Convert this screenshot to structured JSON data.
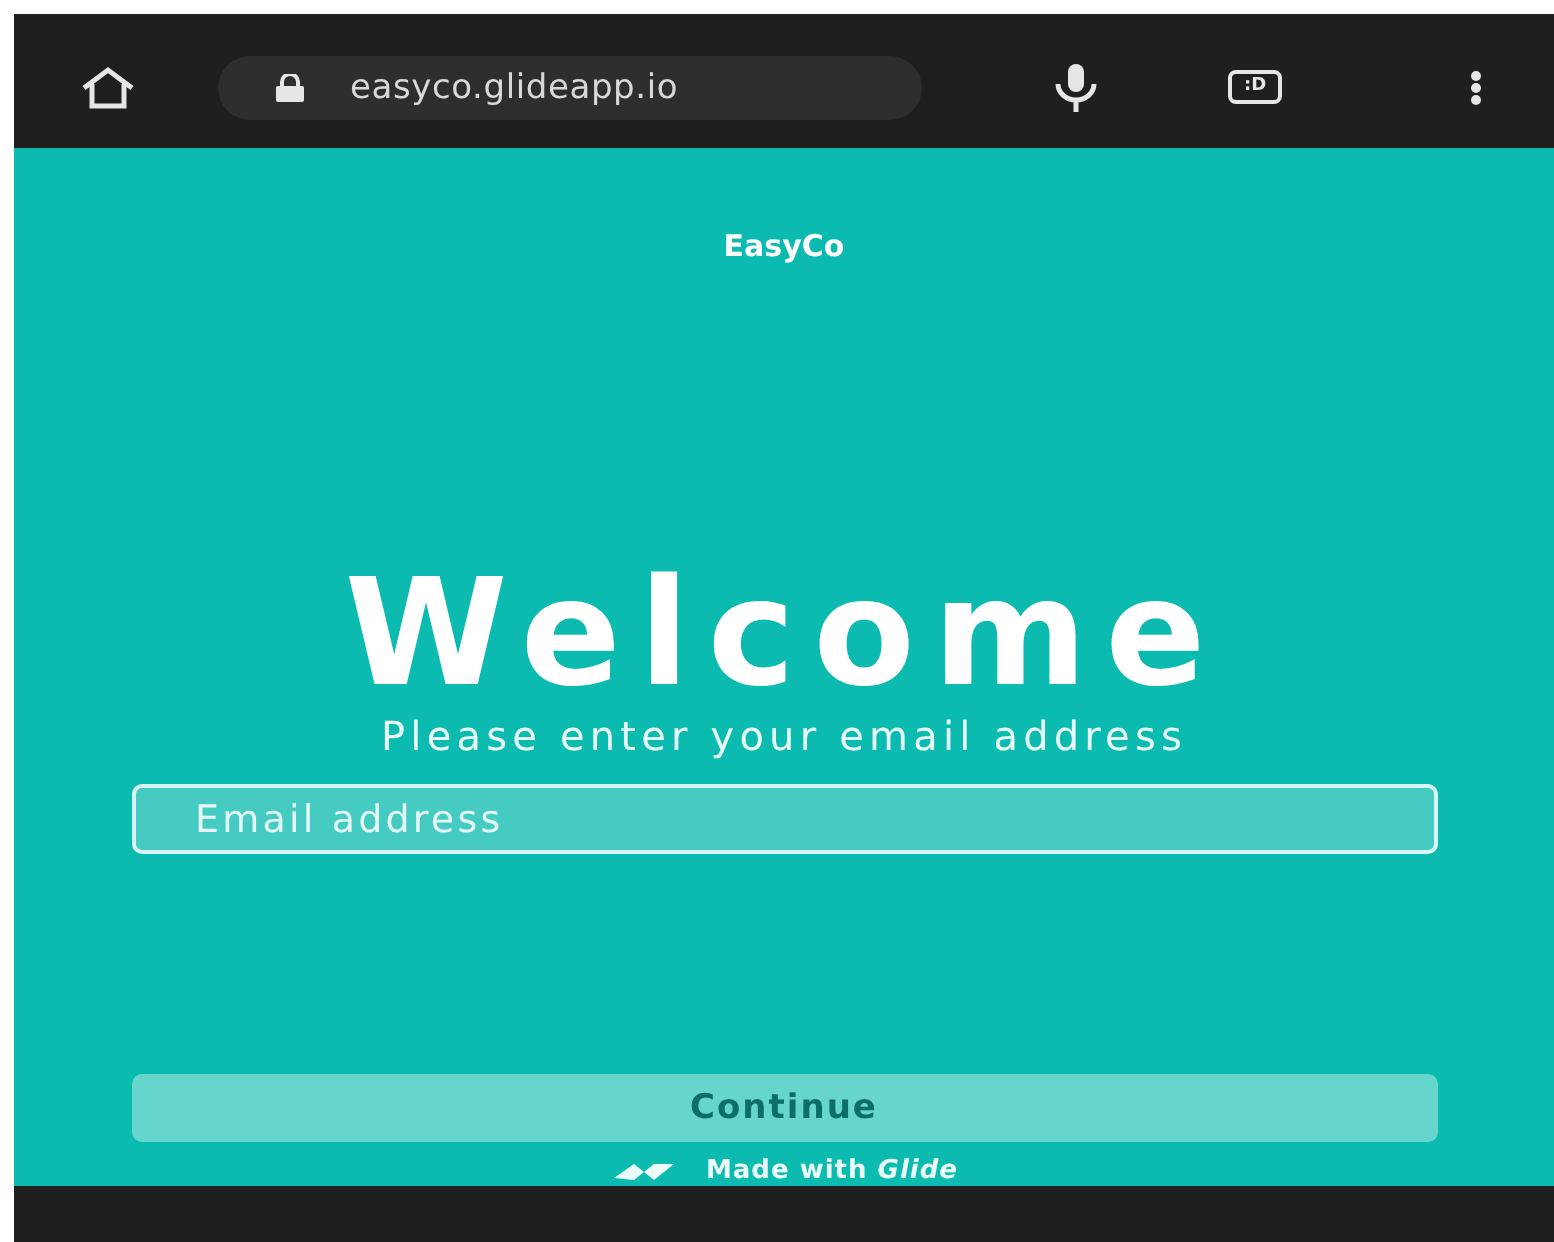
{
  "browser": {
    "url": "easyco.glideapp.io",
    "tabs_label": ":D"
  },
  "app": {
    "title": "EasyCo",
    "heading": "Welcome",
    "subtitle": "Please enter your email address",
    "email_field": {
      "placeholder": "Email address"
    },
    "continue_button": "Continue",
    "footer": "Made with *Glide*"
  }
}
